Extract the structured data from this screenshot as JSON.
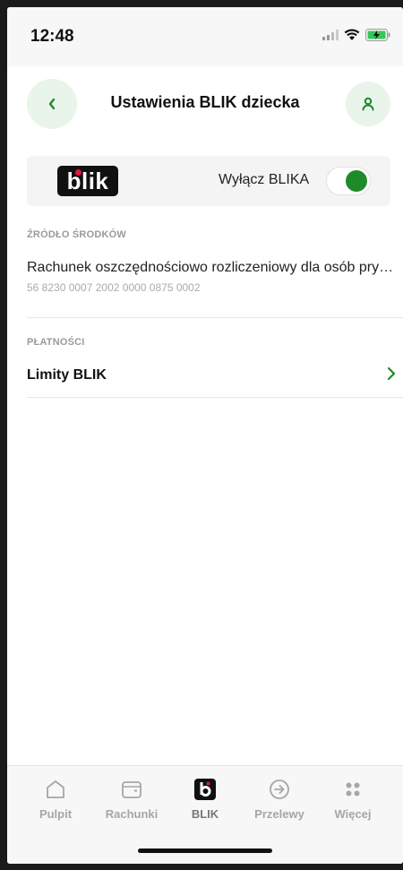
{
  "status_bar": {
    "time": "12:48"
  },
  "header": {
    "title": "Ustawienia BLIK dziecka"
  },
  "blik_card": {
    "logo_text": "blik",
    "toggle_label": "Wyłącz BLIKA",
    "toggle_on": true
  },
  "funds_source": {
    "section_label": "ŹRÓDŁO ŚRODKÓW",
    "account_name": "Rachunek oszczędnościowo rozliczeniowy dla osób prywatnych",
    "account_number": "56 8230 0007 2002 0000 0875 0002"
  },
  "payments": {
    "section_label": "PŁATNOŚCI",
    "items": [
      {
        "label": "Limity BLIK"
      }
    ]
  },
  "tab_bar": {
    "tabs": [
      {
        "label": "Pulpit",
        "icon": "home-icon"
      },
      {
        "label": "Rachunki",
        "icon": "wallet-icon"
      },
      {
        "label": "BLIK",
        "icon": "blik-icon"
      },
      {
        "label": "Przelewy",
        "icon": "arrow-circle-icon"
      },
      {
        "label": "Więcej",
        "icon": "grid-dots-icon"
      }
    ]
  },
  "colors": {
    "accent": "#1e8a2a",
    "accent_light": "#e9f5ea",
    "blik_red": "#e3173e"
  }
}
